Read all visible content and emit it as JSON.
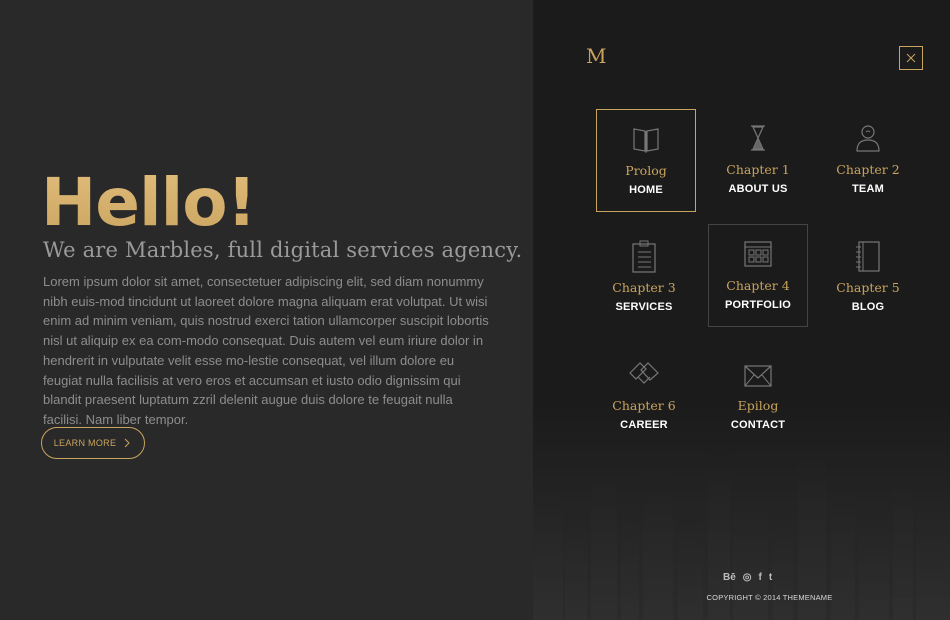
{
  "hero": {
    "heading": "Hello!",
    "tagline": "We are Marbles, full digital services agency.",
    "body": "Lorem ipsum dolor sit amet, consectetuer adipiscing elit, sed diam nonummy nibh euis-mod tincidunt ut laoreet dolore magna aliquam erat volutpat. Ut wisi enim ad minim veniam, quis nostrud exerci tation ullamcorper suscipit lobortis nisl ut aliquip ex ea com-modo consequat. Duis autem vel eum iriure dolor in hendrerit in vulputate velit esse mo-lestie consequat, vel illum dolore eu feugiat nulla facilisis at vero eros et accumsan et iusto odio dignissim qui blandit praesent luptatum zzril delenit augue duis dolore te feugait nulla facilisi. Nam liber tempor.",
    "button_label": "LEARN MORE"
  },
  "menu": {
    "logo": "M",
    "items": [
      {
        "chapter": "Prolog",
        "label": "HOME",
        "icon": "book-icon"
      },
      {
        "chapter": "Chapter 1",
        "label": "ABOUT US",
        "icon": "hourglass-icon"
      },
      {
        "chapter": "Chapter 2",
        "label": "TEAM",
        "icon": "user-icon"
      },
      {
        "chapter": "Chapter 3",
        "label": "SERVICES",
        "icon": "clipboard-icon"
      },
      {
        "chapter": "Chapter 4",
        "label": "PORTFOLIO",
        "icon": "grid-icon"
      },
      {
        "chapter": "Chapter 5",
        "label": "BLOG",
        "icon": "notebook-icon"
      },
      {
        "chapter": "Chapter 6",
        "label": "CAREER",
        "icon": "handshake-icon"
      },
      {
        "chapter": "Epilog",
        "label": "CONTACT",
        "icon": "envelope-icon"
      }
    ]
  },
  "footer": {
    "social": [
      "Bē",
      "◎",
      "f",
      "t"
    ],
    "copyright": "COPYRIGHT © 2014 THEMENAME"
  },
  "colors": {
    "accent": "#c9a45f",
    "left_bg": "#292929",
    "right_bg": "#1b1b1b"
  }
}
